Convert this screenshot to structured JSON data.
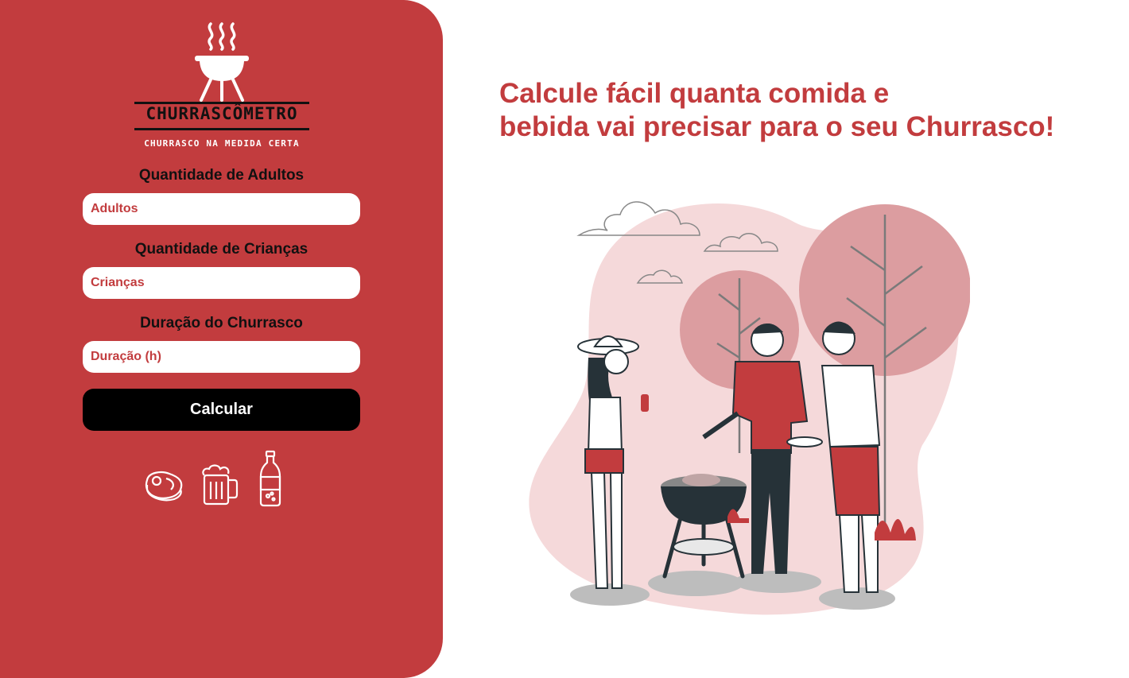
{
  "logo": {
    "title": "CHURRASCÔMETRO",
    "subtitle": "CHURRASCO NA MEDIDA CERTA"
  },
  "form": {
    "adults": {
      "label": "Quantidade de Adultos",
      "placeholder": "Adultos"
    },
    "children": {
      "label": "Quantidade de Crianças",
      "placeholder": "Crianças"
    },
    "duration": {
      "label": "Duração do Churrasco",
      "placeholder": "Duração (h)"
    },
    "submit_label": "Calcular"
  },
  "icons": [
    "steak-icon",
    "beer-mug-icon",
    "soda-bottle-icon"
  ],
  "headline": {
    "line1": "Calcule fácil quanta comida e",
    "line2": "bebida vai precisar para o seu Churrasco!"
  },
  "colors": {
    "brand_red": "#c23c3e",
    "button_bg": "#000000",
    "illustration_pink": "#f5d9da"
  }
}
